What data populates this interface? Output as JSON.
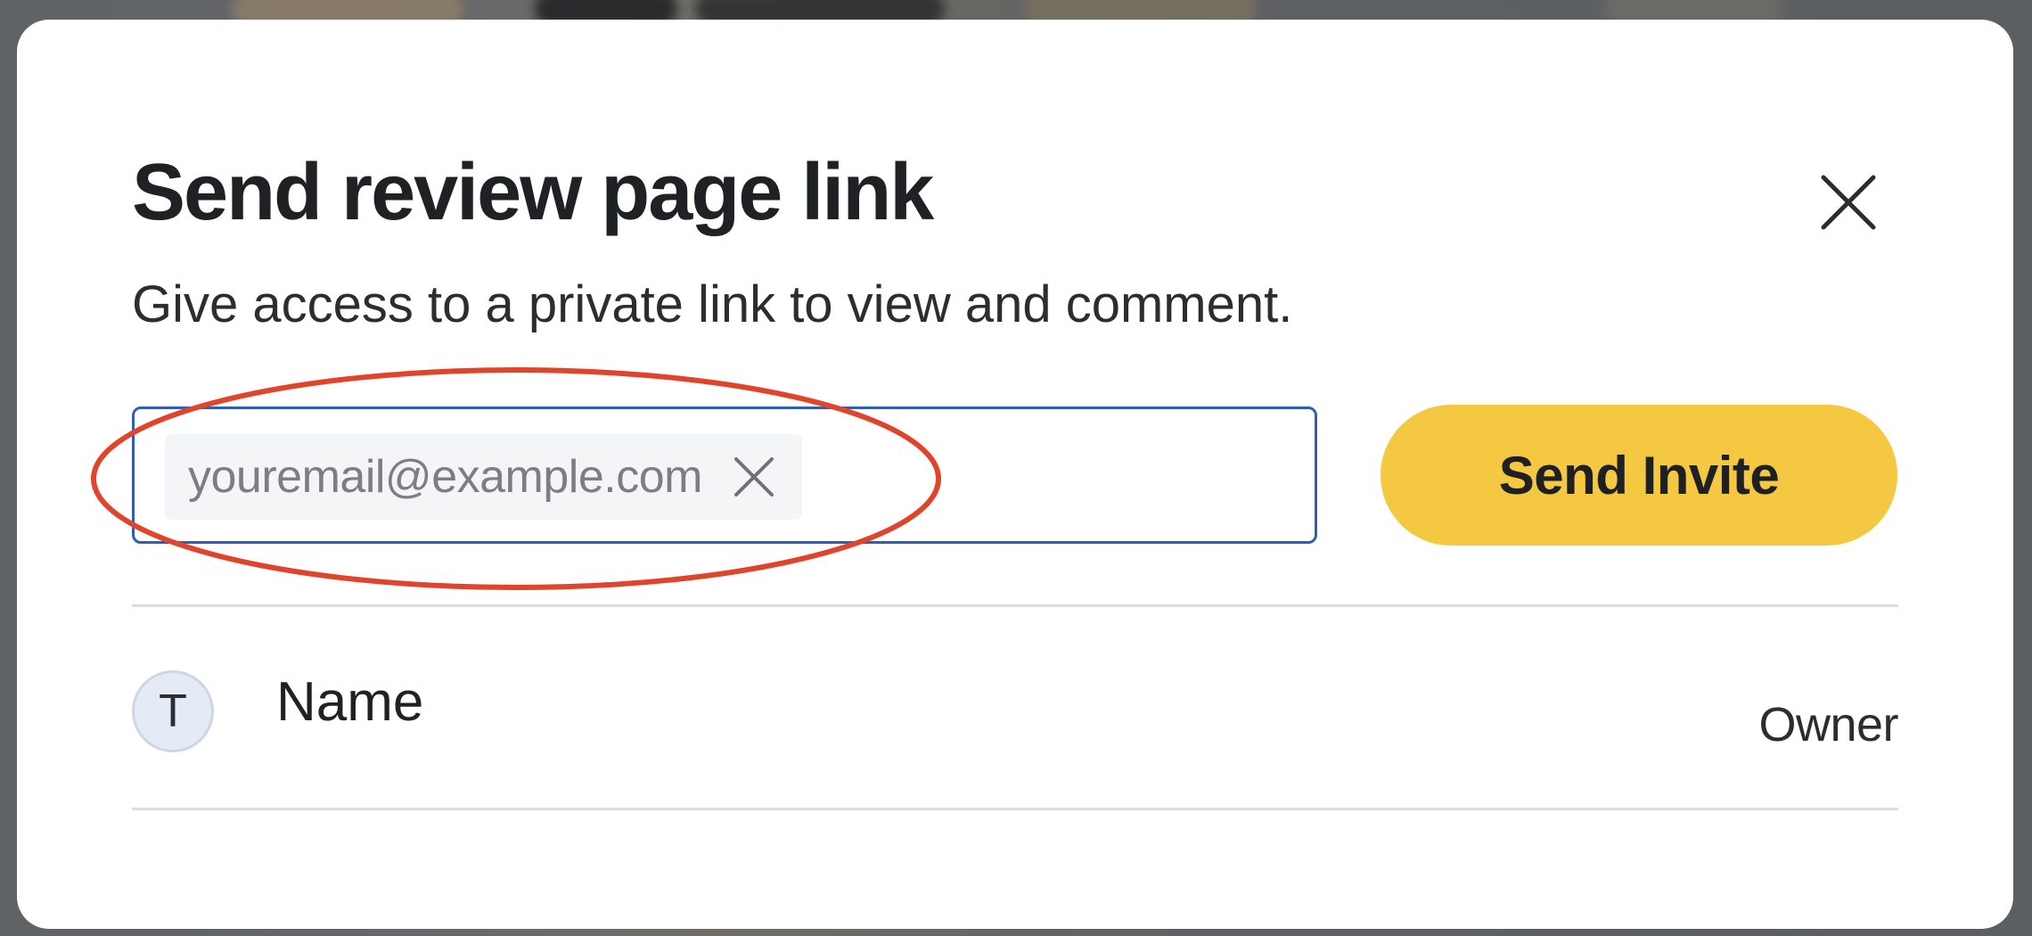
{
  "dialog": {
    "title": "Send review page link",
    "subtitle": "Give access to a private link to view and comment.",
    "close_icon": "close-icon"
  },
  "invite": {
    "email_chip": "youremail@example.com",
    "chip_remove_icon": "close-icon",
    "send_label": "Send Invite"
  },
  "members": [
    {
      "avatar_initial": "T",
      "name": "Name",
      "role": "Owner"
    }
  ],
  "colors": {
    "accent_button": "#F5C842",
    "input_border": "#2F5FB3",
    "annotation": "#E0452B"
  }
}
